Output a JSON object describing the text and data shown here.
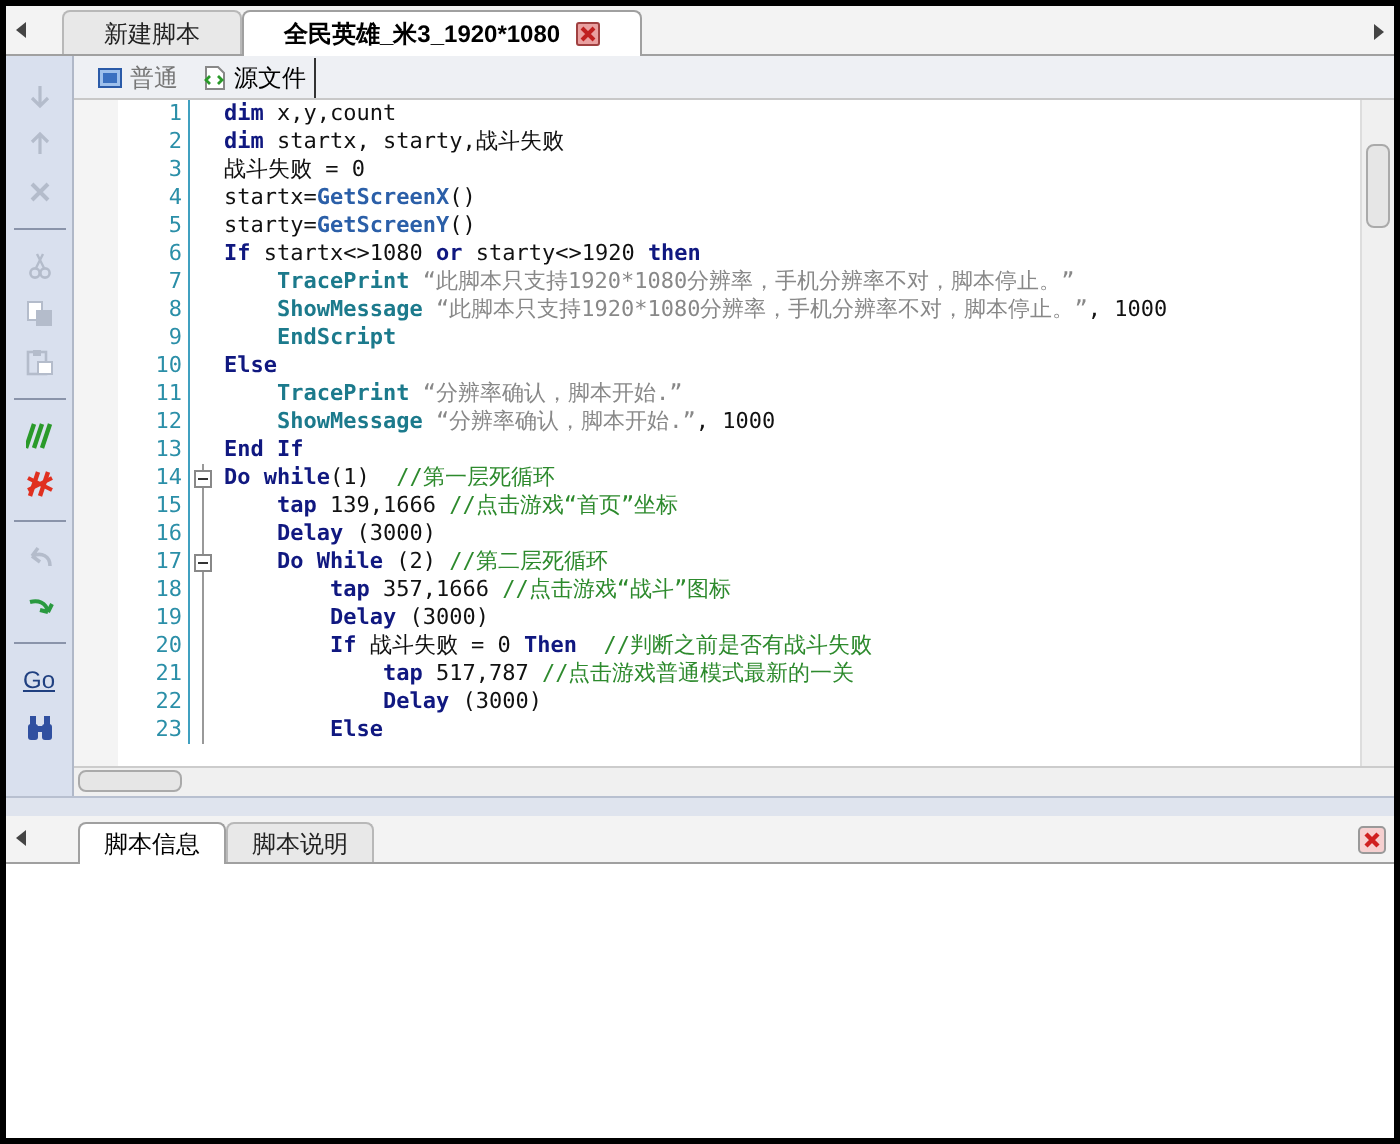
{
  "tabs": [
    {
      "label": "新建脚本",
      "selected": false
    },
    {
      "label": "全民英雄_米3_1920*1080",
      "selected": true,
      "closable": true
    }
  ],
  "toolbar": [
    [
      {
        "kind": "down",
        "disabled": true
      },
      {
        "kind": "up",
        "disabled": true
      },
      {
        "kind": "delete",
        "disabled": true
      }
    ],
    [
      {
        "kind": "cut",
        "disabled": true
      },
      {
        "kind": "copy",
        "disabled": true
      },
      {
        "kind": "paste",
        "disabled": true
      }
    ],
    [
      {
        "kind": "comment",
        "disabled": false
      },
      {
        "kind": "uncomment",
        "disabled": false
      }
    ],
    [
      {
        "kind": "undo",
        "disabled": true
      },
      {
        "kind": "redo",
        "disabled": false
      }
    ],
    [
      {
        "kind": "goto",
        "disabled": false,
        "text": "Go"
      },
      {
        "kind": "find",
        "disabled": false
      }
    ]
  ],
  "view_tabs": [
    {
      "label": "普通",
      "kind": "normal",
      "selected": false
    },
    {
      "label": "源文件",
      "kind": "source",
      "selected": true
    }
  ],
  "editor": {
    "lines": [
      {
        "number": "1",
        "segments": [
          {
            "kind": "keyword",
            "text": "dim"
          },
          {
            "kind": "plain",
            "text": " x,y,count"
          }
        ]
      },
      {
        "number": "2",
        "segments": [
          {
            "kind": "keyword",
            "text": "dim"
          },
          {
            "kind": "plain",
            "text": " startx, starty,战斗失败"
          }
        ]
      },
      {
        "number": "3",
        "segments": [
          {
            "kind": "plain",
            "text": "战斗失败 = 0"
          }
        ]
      },
      {
        "number": "4",
        "segments": [
          {
            "kind": "plain",
            "text": "startx="
          },
          {
            "kind": "function",
            "text": "GetScreenX"
          },
          {
            "kind": "plain",
            "text": "()"
          }
        ]
      },
      {
        "number": "5",
        "segments": [
          {
            "kind": "plain",
            "text": "starty="
          },
          {
            "kind": "function",
            "text": "GetScreenY"
          },
          {
            "kind": "plain",
            "text": "()"
          }
        ]
      },
      {
        "number": "6",
        "segments": [
          {
            "kind": "keyword",
            "text": "If"
          },
          {
            "kind": "plain",
            "text": " startx<>1080 "
          },
          {
            "kind": "keyword",
            "text": "or"
          },
          {
            "kind": "plain",
            "text": " starty<>1920 "
          },
          {
            "kind": "keyword",
            "text": "then"
          }
        ]
      },
      {
        "number": "7",
        "segments": [
          {
            "kind": "command",
            "text": "    TracePrint"
          },
          {
            "kind": "string",
            "text": " “此脚本只支持1920*1080分辨率，手机分辨率不对，脚本停止。”"
          }
        ]
      },
      {
        "number": "8",
        "segments": [
          {
            "kind": "command",
            "text": "    ShowMessage"
          },
          {
            "kind": "string",
            "text": " “此脚本只支持1920*1080分辨率，手机分辨率不对，脚本停止。”"
          },
          {
            "kind": "plain",
            "text": ", 1000"
          }
        ]
      },
      {
        "number": "9",
        "segments": [
          {
            "kind": "command",
            "text": "    EndScript"
          }
        ]
      },
      {
        "number": "10",
        "segments": [
          {
            "kind": "keyword",
            "text": "Else"
          }
        ]
      },
      {
        "number": "11",
        "segments": [
          {
            "kind": "command",
            "text": "    TracePrint"
          },
          {
            "kind": "string",
            "text": " “分辨率确认，脚本开始.”"
          }
        ]
      },
      {
        "number": "12",
        "segments": [
          {
            "kind": "command",
            "text": "    ShowMessage"
          },
          {
            "kind": "string",
            "text": " “分辨率确认，脚本开始.”"
          },
          {
            "kind": "plain",
            "text": ", 1000"
          }
        ]
      },
      {
        "number": "13",
        "segments": [
          {
            "kind": "keyword",
            "text": "End If"
          }
        ]
      },
      {
        "number": "14",
        "foldable": true,
        "segments": [
          {
            "kind": "keyword",
            "text": "Do while"
          },
          {
            "kind": "plain",
            "text": "(1)  "
          },
          {
            "kind": "comment",
            "text": "//第一层死循环"
          }
        ]
      },
      {
        "number": "15",
        "segments": [
          {
            "kind": "keyword",
            "text": "    tap"
          },
          {
            "kind": "plain",
            "text": " 139,1666 "
          },
          {
            "kind": "comment",
            "text": "//点击游戏“首页”坐标"
          }
        ]
      },
      {
        "number": "16",
        "segments": [
          {
            "kind": "keyword",
            "text": "    Delay"
          },
          {
            "kind": "plain",
            "text": " (3000)"
          }
        ]
      },
      {
        "number": "17",
        "foldable": true,
        "segments": [
          {
            "kind": "keyword",
            "text": "    Do While"
          },
          {
            "kind": "plain",
            "text": " (2) "
          },
          {
            "kind": "comment",
            "text": "//第二层死循环"
          }
        ]
      },
      {
        "number": "18",
        "segments": [
          {
            "kind": "keyword",
            "text": "        tap"
          },
          {
            "kind": "plain",
            "text": " 357,1666 "
          },
          {
            "kind": "comment",
            "text": "//点击游戏“战斗”图标"
          }
        ]
      },
      {
        "number": "19",
        "segments": [
          {
            "kind": "keyword",
            "text": "        Delay"
          },
          {
            "kind": "plain",
            "text": " (3000)"
          }
        ]
      },
      {
        "number": "20",
        "segments": [
          {
            "kind": "keyword",
            "text": "        If"
          },
          {
            "kind": "plain",
            "text": " 战斗失败 = 0 "
          },
          {
            "kind": "keyword",
            "text": "Then"
          },
          {
            "kind": "comment",
            "text": "  //判断之前是否有战斗失败"
          }
        ]
      },
      {
        "number": "21",
        "segments": [
          {
            "kind": "keyword",
            "text": "            tap"
          },
          {
            "kind": "plain",
            "text": " 517,787 "
          },
          {
            "kind": "comment",
            "text": "//点击游戏普通模式最新的一关"
          }
        ]
      },
      {
        "number": "22",
        "segments": [
          {
            "kind": "keyword",
            "text": "            Delay"
          },
          {
            "kind": "plain",
            "text": " (3000)"
          }
        ]
      },
      {
        "number": "23",
        "segments": [
          {
            "kind": "keyword",
            "text": "        Else"
          }
        ]
      }
    ]
  },
  "bottom_panel": {
    "tabs": [
      {
        "label": "脚本信息",
        "selected": true
      },
      {
        "label": "脚本说明",
        "selected": false
      }
    ]
  }
}
